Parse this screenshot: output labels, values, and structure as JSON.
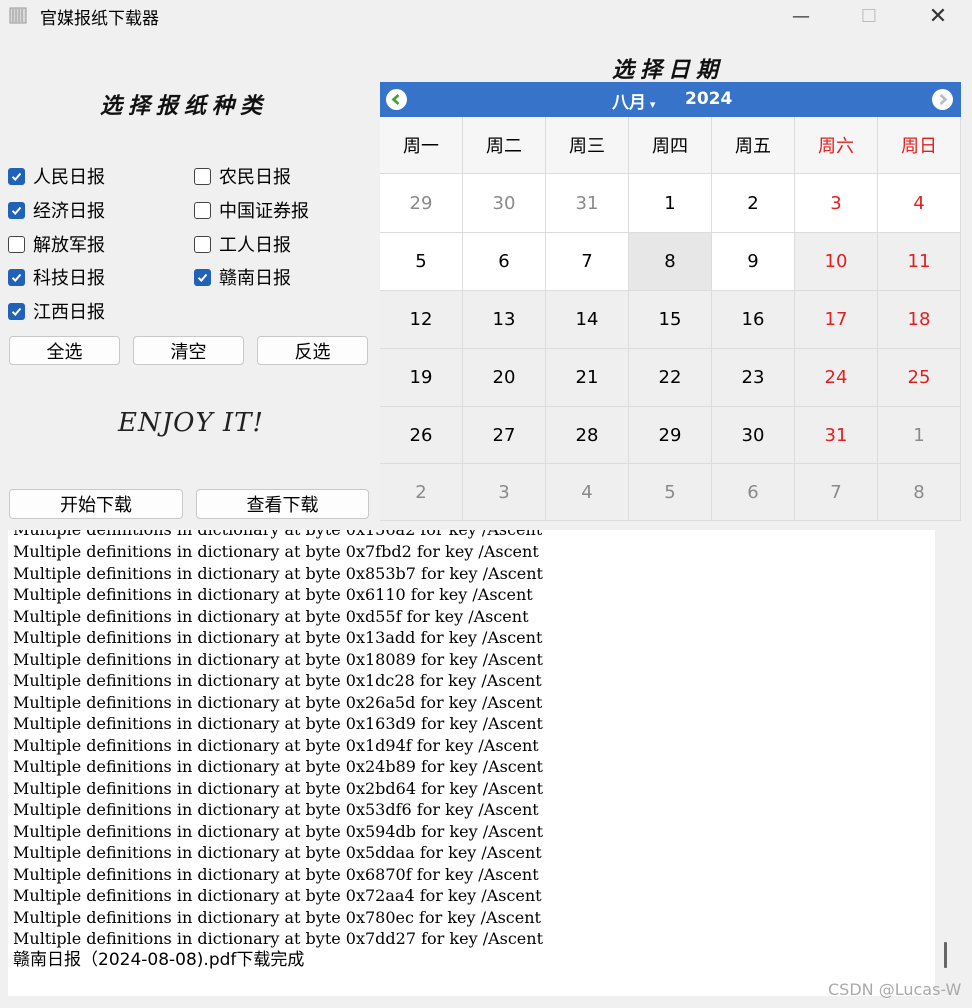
{
  "window": {
    "title": "官媒报纸下载器",
    "minimize": "—",
    "maximize": "☐",
    "close": "✕"
  },
  "papers": {
    "title": "选择报纸种类",
    "items": [
      {
        "label": "人民日报",
        "checked": true
      },
      {
        "label": "农民日报",
        "checked": false
      },
      {
        "label": "经济日报",
        "checked": true
      },
      {
        "label": "中国证券报",
        "checked": false
      },
      {
        "label": "解放军报",
        "checked": false
      },
      {
        "label": "工人日报",
        "checked": false
      },
      {
        "label": "科技日报",
        "checked": true
      },
      {
        "label": "赣南日报",
        "checked": true
      },
      {
        "label": "江西日报",
        "checked": true
      }
    ],
    "select_all": "全选",
    "clear": "清空",
    "invert": "反选"
  },
  "enjoy": "ENJOY IT!",
  "actions": {
    "start": "开始下载",
    "view": "查看下载"
  },
  "calendar": {
    "title": "选择日期",
    "month": "八月",
    "year": "2024",
    "weekdays": [
      "周一",
      "周二",
      "周三",
      "周四",
      "周五",
      "周六",
      "周日"
    ],
    "weeks": [
      [
        "29",
        "30",
        "31",
        "1",
        "2",
        "3",
        "4"
      ],
      [
        "5",
        "6",
        "7",
        "8",
        "9",
        "10",
        "11"
      ],
      [
        "12",
        "13",
        "14",
        "15",
        "16",
        "17",
        "18"
      ],
      [
        "19",
        "20",
        "21",
        "22",
        "23",
        "24",
        "25"
      ],
      [
        "26",
        "27",
        "28",
        "29",
        "30",
        "31",
        "1"
      ],
      [
        "2",
        "3",
        "4",
        "5",
        "6",
        "7",
        "8"
      ]
    ],
    "selected": "8",
    "colors": {
      "header": "#3673c9",
      "weekend": "#e02020",
      "other_month": "#8a8a8a"
    }
  },
  "log": {
    "lines": [
      "Multiple definitions in dictionary at byte 0x7fbd2 for key /Ascent",
      "Multiple definitions in dictionary at byte 0x853b7 for key /Ascent",
      "Multiple definitions in dictionary at byte 0x6110 for key /Ascent",
      "Multiple definitions in dictionary at byte 0xd55f for key /Ascent",
      "Multiple definitions in dictionary at byte 0x13add for key /Ascent",
      "Multiple definitions in dictionary at byte 0x18089 for key /Ascent",
      "Multiple definitions in dictionary at byte 0x1dc28 for key /Ascent",
      "Multiple definitions in dictionary at byte 0x26a5d for key /Ascent",
      "Multiple definitions in dictionary at byte 0x163d9 for key /Ascent",
      "Multiple definitions in dictionary at byte 0x1d94f for key /Ascent",
      "Multiple definitions in dictionary at byte 0x24b89 for key /Ascent",
      "Multiple definitions in dictionary at byte 0x2bd64 for key /Ascent",
      "Multiple definitions in dictionary at byte 0x53df6 for key /Ascent",
      "Multiple definitions in dictionary at byte 0x594db for key /Ascent",
      "Multiple definitions in dictionary at byte 0x5ddaa for key /Ascent",
      "Multiple definitions in dictionary at byte 0x6870f for key /Ascent",
      "Multiple definitions in dictionary at byte 0x72aa4 for key /Ascent",
      "Multiple definitions in dictionary at byte 0x780ec for key /Ascent",
      "Multiple definitions in dictionary at byte 0x7dd27 for key /Ascent",
      "赣南日报（2024-08-08).pdf下载完成"
    ]
  },
  "watermark": "CSDN @Lucas-W"
}
